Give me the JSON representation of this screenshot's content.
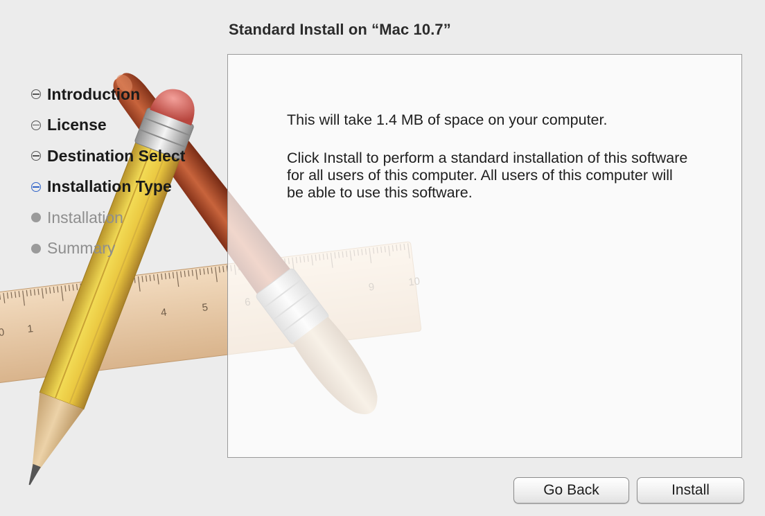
{
  "header": {
    "title": "Standard Install on “Mac 10.7”"
  },
  "sidebar": {
    "steps": [
      {
        "label": "Introduction",
        "state": "completed"
      },
      {
        "label": "License",
        "state": "completed"
      },
      {
        "label": "Destination Select",
        "state": "completed"
      },
      {
        "label": "Installation Type",
        "state": "current"
      },
      {
        "label": "Installation",
        "state": "upcoming"
      },
      {
        "label": "Summary",
        "state": "upcoming"
      }
    ]
  },
  "content": {
    "space_note": "This will take 1.4 MB of space on your computer.",
    "description": "Click Install to perform a standard installation of this software for all users of this computer. All users of this computer will be able to use this software."
  },
  "buttons": {
    "go_back": "Go Back",
    "install": "Install"
  },
  "artwork": {
    "ruler_numbers": [
      "0",
      "1",
      "4",
      "5",
      "6",
      "9",
      "10"
    ]
  },
  "colors": {
    "current_step": "#2f63c8",
    "completed_step": "#555555",
    "upcoming_step": "#9a9a9a",
    "window_background": "#ececec"
  }
}
